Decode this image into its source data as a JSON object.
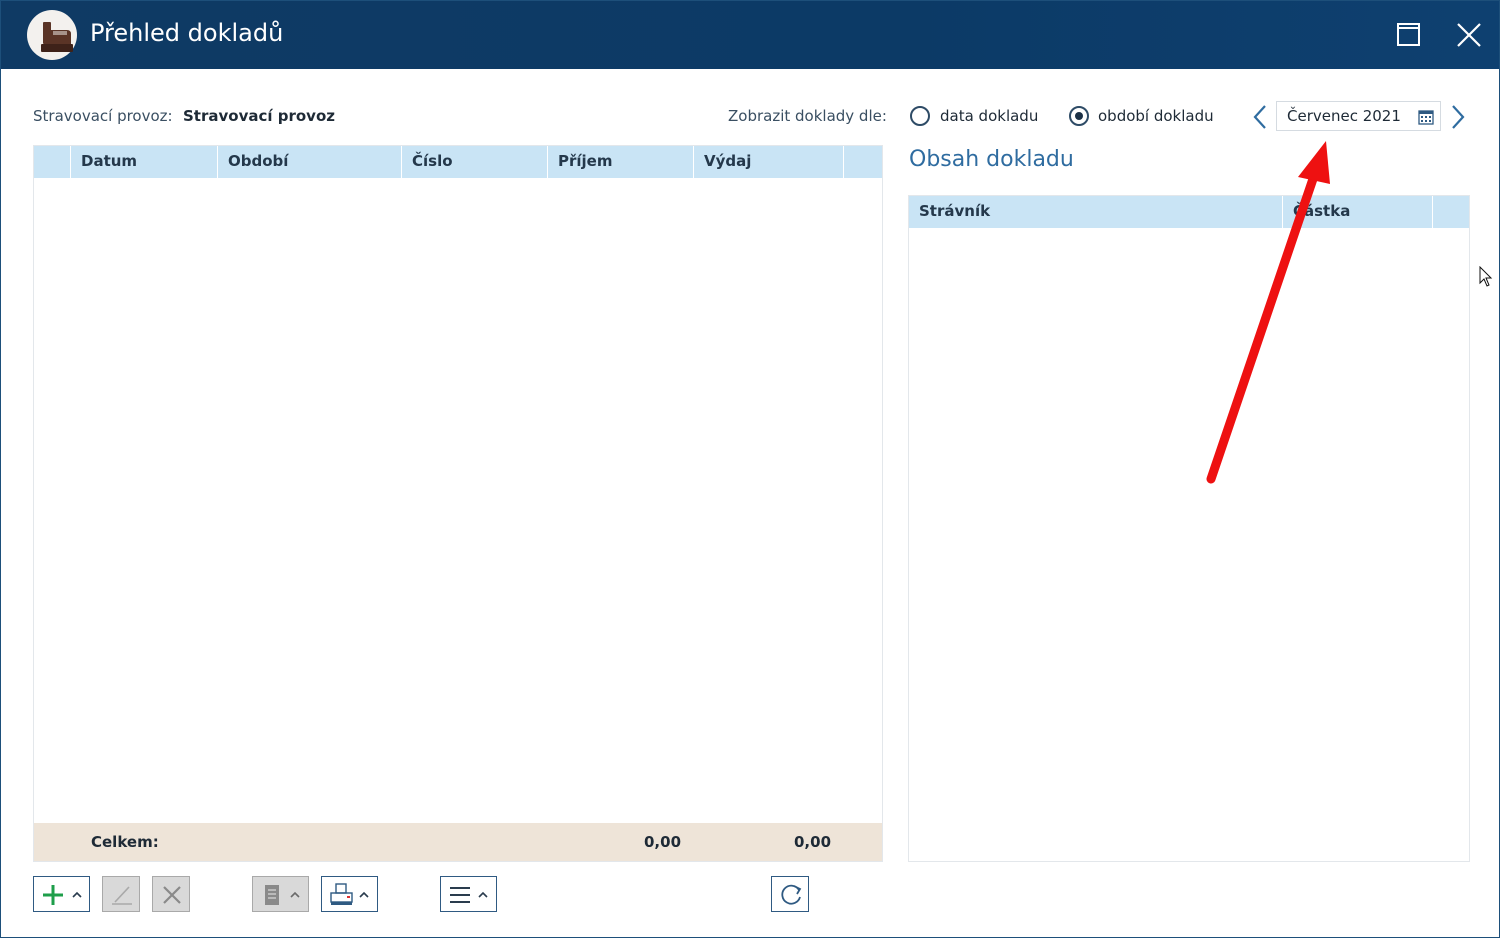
{
  "window": {
    "title": "Přehled dokladů"
  },
  "filters": {
    "provoz_label": "Stravovací provoz:",
    "provoz_value": "Stravovací provoz",
    "display_by_label": "Zobrazit doklady dle:",
    "radio_date_label": "data dokladu",
    "radio_period_label": "období dokladu",
    "selected_radio": "období dokladu",
    "period_value": "Červenec 2021"
  },
  "main_table": {
    "columns": [
      "Datum",
      "Období",
      "Číslo",
      "Příjem",
      "Výdaj"
    ],
    "rows": [],
    "footer": {
      "label": "Celkem:",
      "income_total": "0,00",
      "expense_total": "0,00"
    }
  },
  "detail": {
    "title": "Obsah dokladu",
    "columns": [
      "Strávník",
      "Částka"
    ],
    "rows": []
  },
  "colors": {
    "titlebar": "#0f3a64",
    "header_row": "#c9e4f5",
    "footer_row": "#eee4d8",
    "accent": "#2f6ca0",
    "annotation_arrow": "#ee1111",
    "add_green": "#1e9e4a"
  },
  "toolbar_icons": [
    "add-icon",
    "edit-icon",
    "delete-icon",
    "document-icon",
    "print-icon",
    "menu-icon",
    "refresh-icon"
  ]
}
